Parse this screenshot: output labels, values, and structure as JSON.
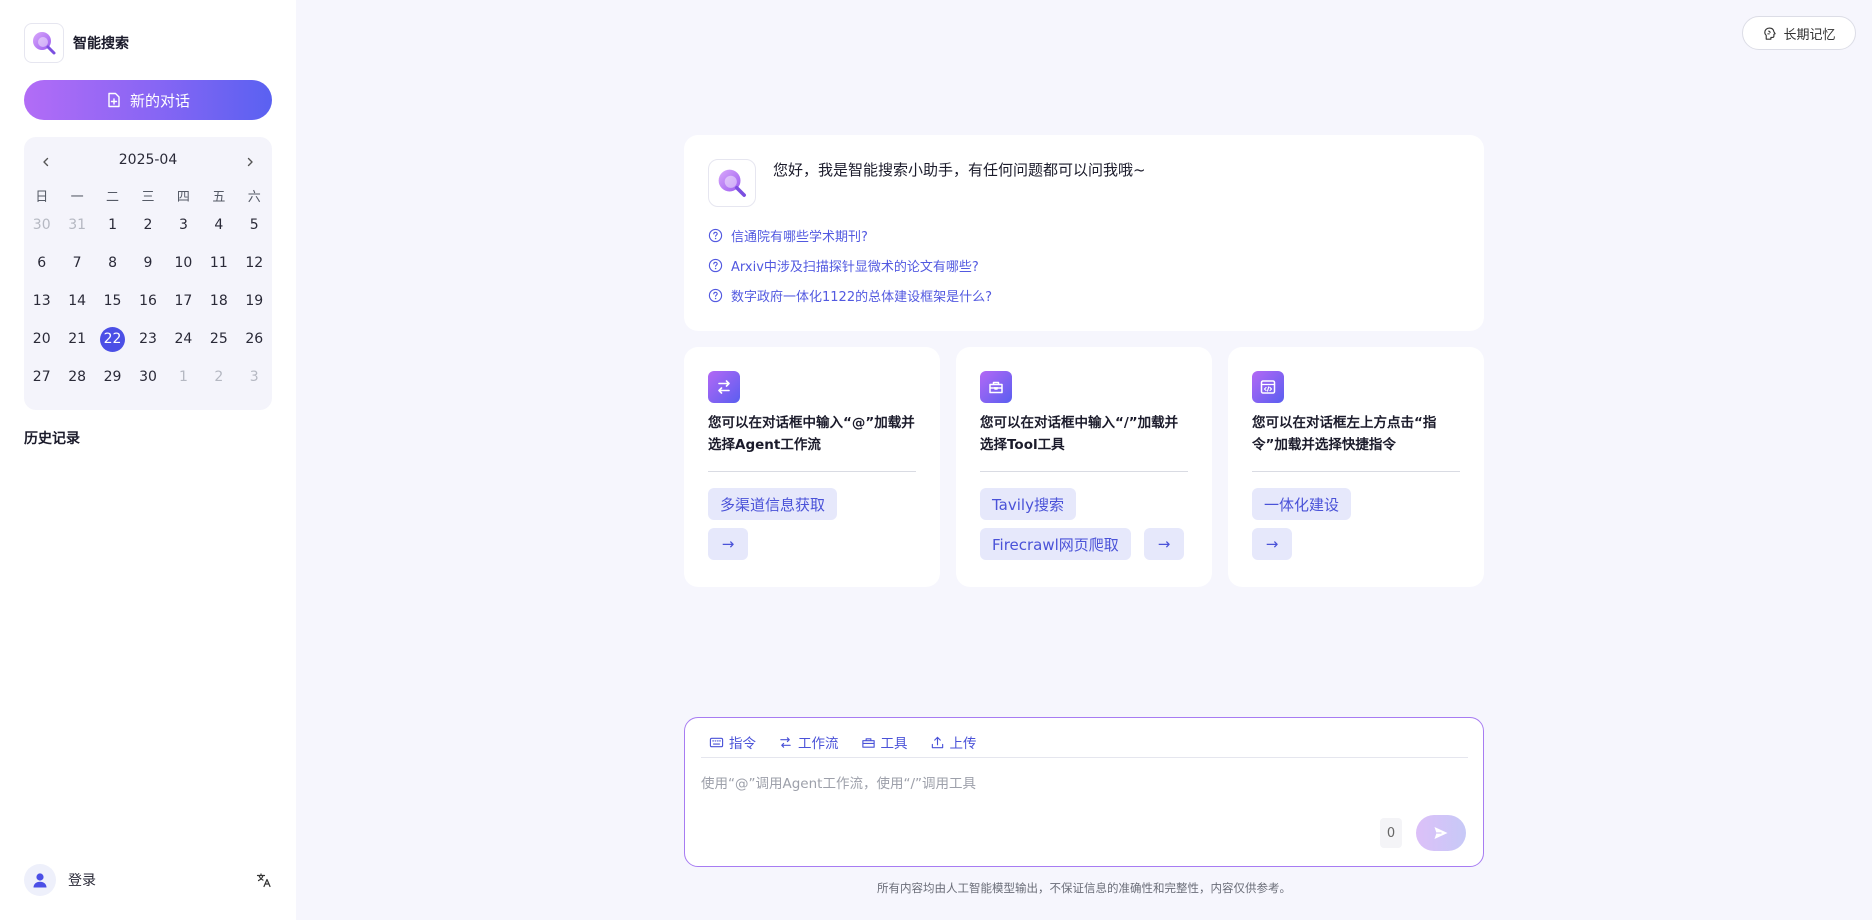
{
  "app": {
    "name": "智能搜索"
  },
  "sidebar": {
    "new_chat_label": "新的对话",
    "history_title": "历史记录",
    "login_label": "登录"
  },
  "calendar": {
    "title": "2025-04",
    "weekdays": [
      "日",
      "一",
      "二",
      "三",
      "四",
      "五",
      "六"
    ],
    "days": [
      {
        "d": "30",
        "muted": true
      },
      {
        "d": "31",
        "muted": true
      },
      {
        "d": "1"
      },
      {
        "d": "2"
      },
      {
        "d": "3"
      },
      {
        "d": "4"
      },
      {
        "d": "5"
      },
      {
        "d": "6"
      },
      {
        "d": "7"
      },
      {
        "d": "8"
      },
      {
        "d": "9"
      },
      {
        "d": "10"
      },
      {
        "d": "11"
      },
      {
        "d": "12"
      },
      {
        "d": "13"
      },
      {
        "d": "14"
      },
      {
        "d": "15"
      },
      {
        "d": "16"
      },
      {
        "d": "17"
      },
      {
        "d": "18"
      },
      {
        "d": "19"
      },
      {
        "d": "20"
      },
      {
        "d": "21"
      },
      {
        "d": "22",
        "today": true
      },
      {
        "d": "23"
      },
      {
        "d": "24"
      },
      {
        "d": "25"
      },
      {
        "d": "26"
      },
      {
        "d": "27"
      },
      {
        "d": "28"
      },
      {
        "d": "29"
      },
      {
        "d": "30"
      },
      {
        "d": "1",
        "muted": true
      },
      {
        "d": "2",
        "muted": true
      },
      {
        "d": "3",
        "muted": true
      }
    ]
  },
  "header": {
    "memory_label": "长期记忆"
  },
  "welcome": {
    "greeting": "您好，我是智能搜索小助手，有任何问题都可以问我哦~",
    "suggestions": [
      "信通院有哪些学术期刊?",
      "Arxiv中涉及扫描探针显微术的论文有哪些?",
      "数字政府一体化1122的总体建设框架是什么?"
    ]
  },
  "features": [
    {
      "icon": "workflow-icon",
      "description": "您可以在对话框中输入“@”加载并选择Agent工作流",
      "chips": [
        "多渠道信息获取"
      ],
      "arrow": "→"
    },
    {
      "icon": "toolbox-icon",
      "description": "您可以在对话框中输入“/”加载并选择Tool工具",
      "chips": [
        "Tavily搜索",
        "Firecrawl网页爬取"
      ],
      "arrow": "→"
    },
    {
      "icon": "code-window-icon",
      "description": "您可以在对话框左上方点击“指令”加载并选择快捷指令",
      "chips": [
        "一体化建设"
      ],
      "arrow": "→"
    }
  ],
  "composer": {
    "tools": [
      "指令",
      "工作流",
      "工具",
      "上传"
    ],
    "placeholder": "使用“@”调用Agent工作流，使用“/”调用工具",
    "char_count": "0"
  },
  "disclaimer": "所有内容均由人工智能模型输出，不保证信息的准确性和完整性，内容仅供参考。",
  "colors": {
    "accent": "#4b4fe6",
    "gradient_start": "#b26cf6",
    "gradient_end": "#5a61f1"
  }
}
